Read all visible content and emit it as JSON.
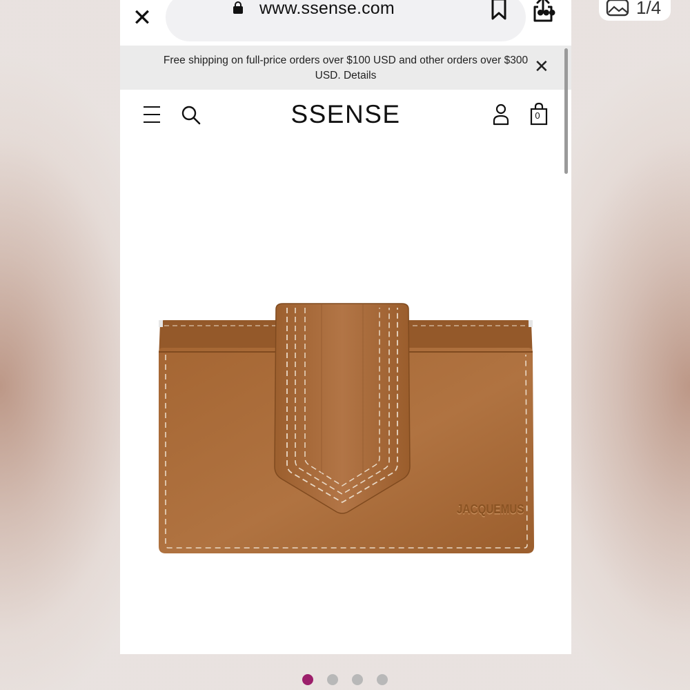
{
  "browser": {
    "close_icon": "close-icon",
    "url": "www.ssense.com",
    "lock_icon": "lock-icon",
    "bookmark_icon": "bookmark-icon",
    "share_icon": "share-icon",
    "more_icon": "more-dots-icon",
    "more_glyph": "•••",
    "close_glyph": "✕"
  },
  "promo": {
    "text": "Free shipping on full-price orders over $100 USD and other orders over $300 USD. Details",
    "close_glyph": "✕"
  },
  "header": {
    "logo": "SSENSE",
    "menu_icon": "hamburger-menu-icon",
    "search_icon": "search-icon",
    "account_icon": "account-icon",
    "bag_icon": "shopping-bag-icon",
    "bag_count": "0"
  },
  "product": {
    "image": "leather-cardholder-image",
    "brand_emboss": "JACQUEMUS",
    "leather_color": "#a86a37",
    "stitch_color": "#e9d9c6"
  },
  "carousel": {
    "total": 4,
    "active_index": 0,
    "active_color": "#9c1f6b",
    "inactive_color": "#b8b8b8"
  },
  "photo_counter": {
    "text": "1/4",
    "icon": "gallery-icon"
  }
}
